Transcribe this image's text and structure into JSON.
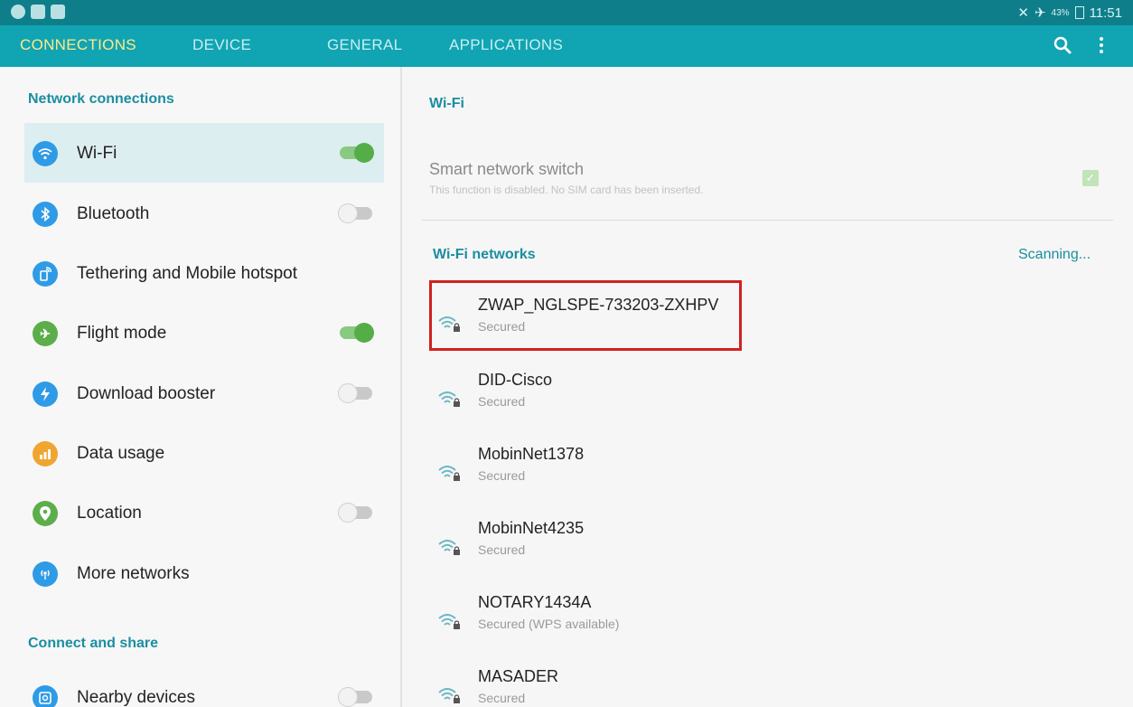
{
  "status_bar": {
    "battery": "43%",
    "time": "11:51"
  },
  "tabs": [
    {
      "label": "CONNECTIONS",
      "active": true
    },
    {
      "label": "DEVICE",
      "active": false
    },
    {
      "label": "GENERAL",
      "active": false
    },
    {
      "label": "APPLICATIONS",
      "active": false
    }
  ],
  "left_pane": {
    "section1": "Network connections",
    "section2": "Connect and share",
    "items": [
      {
        "label": "Wi-Fi",
        "icon": "wifi-icon",
        "color": "#2f9be6",
        "toggle": "on",
        "selected": true
      },
      {
        "label": "Bluetooth",
        "icon": "bluetooth-icon",
        "color": "#2f9be6",
        "toggle": "off"
      },
      {
        "label": "Tethering and Mobile hotspot",
        "icon": "hotspot-icon",
        "color": "#2f9be6",
        "toggle": null
      },
      {
        "label": "Flight mode",
        "icon": "airplane-icon",
        "color": "#5cae4a",
        "toggle": "on"
      },
      {
        "label": "Download booster",
        "icon": "lightning-icon",
        "color": "#2f9be6",
        "toggle": "off"
      },
      {
        "label": "Data usage",
        "icon": "data-usage-icon",
        "color": "#f0a531",
        "toggle": null
      },
      {
        "label": "Location",
        "icon": "location-icon",
        "color": "#5cae4a",
        "toggle": "off"
      },
      {
        "label": "More networks",
        "icon": "more-networks-icon",
        "color": "#2f9be6",
        "toggle": null
      },
      {
        "label": "Nearby devices",
        "icon": "nearby-devices-icon",
        "color": "#2f9be6",
        "toggle": "off"
      }
    ]
  },
  "right_pane": {
    "title": "Wi-Fi",
    "smart_switch_title": "Smart network switch",
    "smart_switch_desc": "This function is disabled. No SIM card has been inserted.",
    "networks_title": "Wi-Fi networks",
    "scanning": "Scanning...",
    "networks": [
      {
        "name": "ZWAP_NGLSPE-733203-ZXHPV",
        "status": "Secured",
        "highlighted": true
      },
      {
        "name": "DID-Cisco",
        "status": "Secured"
      },
      {
        "name": "MobinNet1378",
        "status": "Secured"
      },
      {
        "name": "MobinNet4235",
        "status": "Secured"
      },
      {
        "name": "NOTARY1434A",
        "status": "Secured (WPS available)"
      },
      {
        "name": "MASADER",
        "status": "Secured"
      }
    ]
  },
  "colors": {
    "status_bar": "#0e7f8a",
    "tab_bar": "#11a4b2",
    "active_tab": "#ffe98a",
    "accent": "#1b8ea0",
    "highlight_border": "#d32020"
  }
}
